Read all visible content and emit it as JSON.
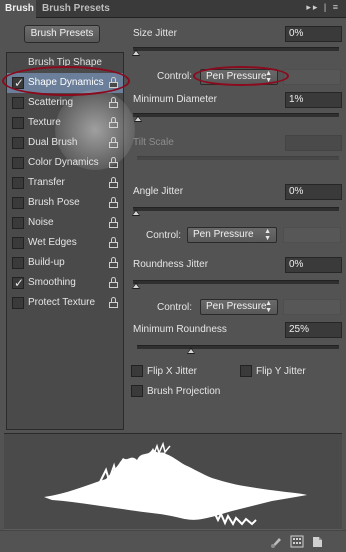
{
  "tabs": {
    "active": "Brush",
    "inactive": "Brush Presets",
    "tools": "▸▸ | ≡"
  },
  "presets_button": "Brush Presets",
  "left_panel": {
    "header": "Brush Tip Shape",
    "options": [
      {
        "label": "Shape Dynamics",
        "checked": true,
        "selected": true,
        "enabled": true
      },
      {
        "label": "Scattering",
        "checked": false,
        "selected": false,
        "enabled": true
      },
      {
        "label": "Texture",
        "checked": false,
        "selected": false,
        "enabled": true
      },
      {
        "label": "Dual Brush",
        "checked": false,
        "selected": false,
        "enabled": true
      },
      {
        "label": "Color Dynamics",
        "checked": false,
        "selected": false,
        "enabled": true
      },
      {
        "label": "Transfer",
        "checked": false,
        "selected": false,
        "enabled": true
      },
      {
        "label": "Brush Pose",
        "checked": false,
        "selected": false,
        "enabled": true
      },
      {
        "label": "Noise",
        "checked": false,
        "selected": false,
        "enabled": true
      },
      {
        "label": "Wet Edges",
        "checked": false,
        "selected": false,
        "enabled": true
      },
      {
        "label": "Build-up",
        "checked": false,
        "selected": false,
        "enabled": true
      },
      {
        "label": "Smoothing",
        "checked": true,
        "selected": false,
        "enabled": true
      },
      {
        "label": "Protect Texture",
        "checked": false,
        "selected": false,
        "enabled": true
      }
    ]
  },
  "right_panel": {
    "size_jitter": {
      "label": "Size Jitter",
      "value": "0%",
      "slider": 0
    },
    "size_control": {
      "label": "Control:",
      "value": "Pen Pressure"
    },
    "minimum_diameter": {
      "label": "Minimum Diameter",
      "value": "1%",
      "slider": 0.01
    },
    "tilt_scale": {
      "label": "Tilt Scale",
      "value": ""
    },
    "angle_jitter": {
      "label": "Angle Jitter",
      "value": "0%",
      "slider": 0
    },
    "angle_control": {
      "label": "Control:",
      "value": "Pen Pressure"
    },
    "roundness_jitter": {
      "label": "Roundness Jitter",
      "value": "0%",
      "slider": 0
    },
    "roundness_control": {
      "label": "Control:",
      "value": "Pen Pressure"
    },
    "minimum_roundness": {
      "label": "Minimum Roundness",
      "value": "25%",
      "slider": 0.25
    },
    "flip_x": {
      "label": "Flip X Jitter",
      "checked": false
    },
    "flip_y": {
      "label": "Flip Y Jitter",
      "checked": false
    },
    "brush_projection": {
      "label": "Brush Projection",
      "checked": false
    }
  },
  "colors": {
    "panel": "#535353",
    "selected_row": "#6b7f9b",
    "highlight_ellipse": "#8b0a1e",
    "stroke": "#ffffff"
  },
  "icons": {
    "bottom": [
      "brush-toggle-icon",
      "grid-icon",
      "new-preset-icon"
    ]
  }
}
